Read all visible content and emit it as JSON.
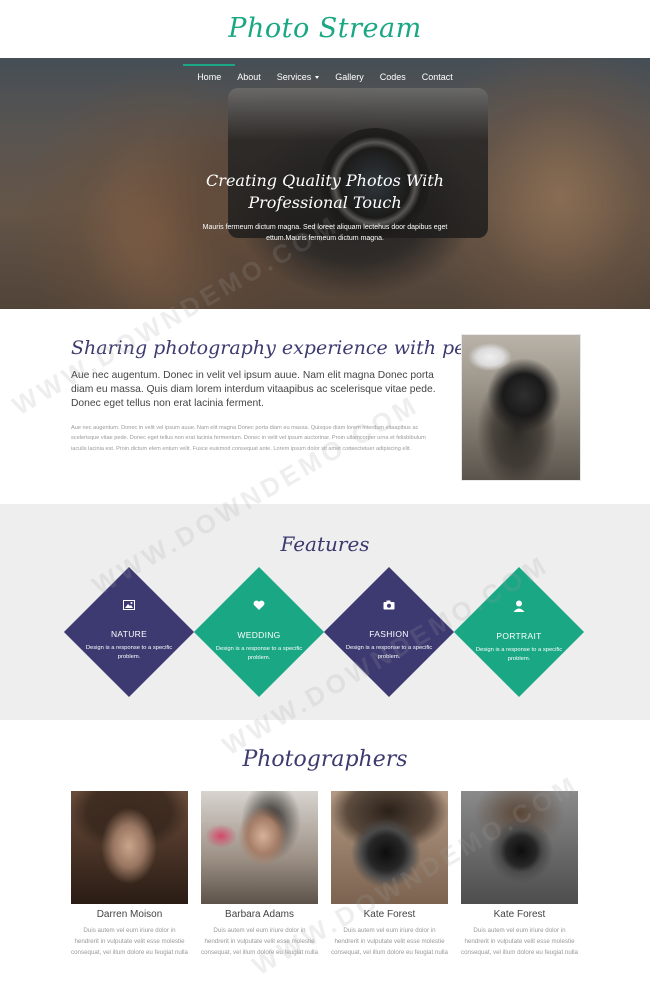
{
  "brand": {
    "logo": "Photo Stream",
    "accent": "#1aa784",
    "purple": "#3d3a72"
  },
  "nav": [
    {
      "label": "Home",
      "active": true
    },
    {
      "label": "About"
    },
    {
      "label": "Services",
      "dropdown": true
    },
    {
      "label": "Gallery"
    },
    {
      "label": "Codes"
    },
    {
      "label": "Contact"
    }
  ],
  "hero": {
    "title_line1": "Creating Quality Photos With",
    "title_line2": "Professional Touch",
    "text_line1": "Mauris fermeum dictum magna. Sed loreet aliquam lectehus door dapibus eget",
    "text_line2": "ettum.Mauris fermeum dictum magna."
  },
  "about": {
    "title": "Sharing photography experience with people",
    "lead": "Aue nec augentum. Donec in velit vel ipsum auue. Nam elit magna Donec porta diam eu massa. Quis diam lorem interdum vitaapibus ac scelerisque vitae pede. Donec eget tellus non erat lacinia ferment.",
    "small": "Aue nec augentum. Donec in velit vel ipsum auue. Nam elit magna Donec porta diam eu massa. Quisque diam lorem interdum vitaapibus ac scelerisque vitae pede. Donec eget tellus non erat lacinia fermentum. Donec in velit vel ipsum auctorinar. Proin ullamcorper urna et felisbibulum iaculis lacinia est. Proin dictum elem entum velit. Fusce euismod consequat ante. Lorem ipsum dolor sit amet consectetuer adipiscing elit."
  },
  "features": {
    "title": "Features",
    "items": [
      {
        "name": "NATURE",
        "desc": "Design is a response to a specific problem.",
        "icon": "image-icon",
        "color": "purple"
      },
      {
        "name": "WEDDING",
        "desc": "Design is a response to a specific problem.",
        "icon": "heart-icon",
        "color": "green"
      },
      {
        "name": "FASHION",
        "desc": "Design is a response to a specific problem.",
        "icon": "camera-icon",
        "color": "purple"
      },
      {
        "name": "PORTRAIT",
        "desc": "Design is a response to a specific problem.",
        "icon": "user-icon",
        "color": "green"
      }
    ]
  },
  "photographers": {
    "title": "Photographers",
    "items": [
      {
        "name": "Darren Moison",
        "desc": "Duis autem vel eum iriure dolor in hendrerit in vulputate velit esse molestie consequat, vel illum dolore eu feugiat nulla"
      },
      {
        "name": "Barbara Adams",
        "desc": "Duis autem vel eum iriure dolor in hendrerit in vulputate velit esse molestie consequat, vel illum dolore eu feugiat nulla"
      },
      {
        "name": "Kate Forest",
        "desc": "Duis autem vel eum iriure dolor in hendrerit in vulputate velit esse molestie consequat, vel illum dolore eu feugiat nulla"
      },
      {
        "name": "Kate Forest",
        "desc": "Duis autem vel eum iriure dolor in hendrerit in vulputate velit esse molestie consequat, vel illum dolore eu feugiat nulla"
      }
    ]
  },
  "watermark": "WWW.DOWNDEMO.COM"
}
